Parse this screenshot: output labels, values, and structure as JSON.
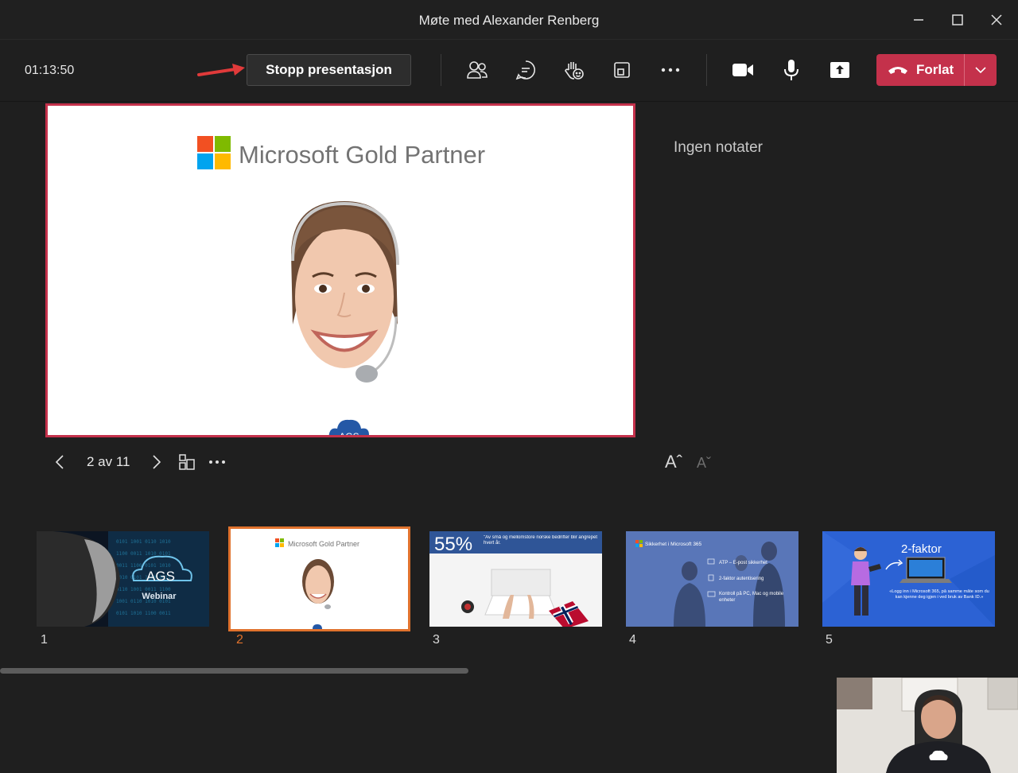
{
  "window": {
    "title": "Møte med Alexander Renberg"
  },
  "toolbar": {
    "timer": "01:13:50",
    "stop_presenting_label": "Stopp presentasjon",
    "leave_label": "Forlat"
  },
  "slide": {
    "heading": "Microsoft Gold Partner",
    "logo_text": "AGS"
  },
  "notes": {
    "empty_text": "Ingen notater"
  },
  "navigation": {
    "counter": "2 av 11",
    "font_increase": "Aˆ",
    "font_decrease": "Aˇ"
  },
  "thumbnails": [
    {
      "number": "1",
      "text": "AGS",
      "subtext": "Webinar"
    },
    {
      "number": "2",
      "text": "Microsoft Gold Partner"
    },
    {
      "number": "3",
      "text": "55%",
      "subtext": "\"Av små og mellomstore norske bedrifter blir angrepet hvert år."
    },
    {
      "number": "4",
      "text": "Sikkerhet i Microsoft 365",
      "items": [
        "ATP – E-post sikkerhet",
        "2-faktor autentisering",
        "Kontroll på PC, Mac og mobile enheter"
      ]
    },
    {
      "number": "5",
      "text": "2-faktor",
      "subtext": "«Logg inn i Microsoft 365, på samme måte som du kan kjenne deg igjen i ved bruk av Bank ID.»"
    }
  ],
  "colors": {
    "accent_red": "#c4314b",
    "selected_orange": "#e0722d",
    "slide_blue": "#2f5597"
  }
}
